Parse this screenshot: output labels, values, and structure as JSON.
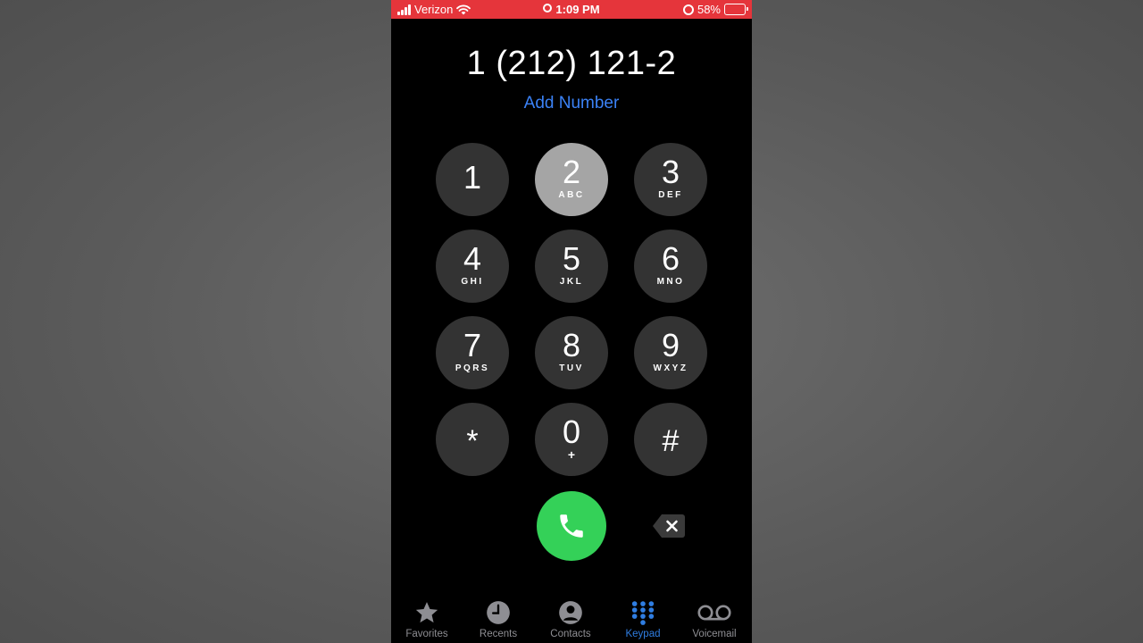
{
  "status_bar": {
    "carrier": "Verizon",
    "time": "1:09 PM",
    "battery": "58%",
    "battery_level": 0.58,
    "background": "#e5353b"
  },
  "dialer": {
    "number": "1 (212) 121-2",
    "add_number_label": "Add Number",
    "keys": [
      {
        "digit": "1",
        "letters": ""
      },
      {
        "digit": "2",
        "letters": "ABC",
        "state": "pressed"
      },
      {
        "digit": "3",
        "letters": "DEF"
      },
      {
        "digit": "4",
        "letters": "GHI"
      },
      {
        "digit": "5",
        "letters": "JKL"
      },
      {
        "digit": "6",
        "letters": "MNO"
      },
      {
        "digit": "7",
        "letters": "PQRS"
      },
      {
        "digit": "8",
        "letters": "TUV"
      },
      {
        "digit": "9",
        "letters": "WXYZ"
      },
      {
        "digit": "*",
        "letters": ""
      },
      {
        "digit": "0",
        "letters": "+"
      },
      {
        "digit": "#",
        "letters": ""
      }
    ],
    "call_icon": "phone-icon",
    "delete_icon": "backspace-icon",
    "call_color": "#34d158"
  },
  "tab_bar": {
    "tabs": [
      {
        "label": "Favorites",
        "icon": "star-icon"
      },
      {
        "label": "Recents",
        "icon": "clock-icon"
      },
      {
        "label": "Contacts",
        "icon": "person-circle-icon"
      },
      {
        "label": "Keypad",
        "icon": "keypad-grid-icon",
        "active": true
      },
      {
        "label": "Voicemail",
        "icon": "voicemail-icon"
      }
    ],
    "active_color": "#2f7de1"
  }
}
